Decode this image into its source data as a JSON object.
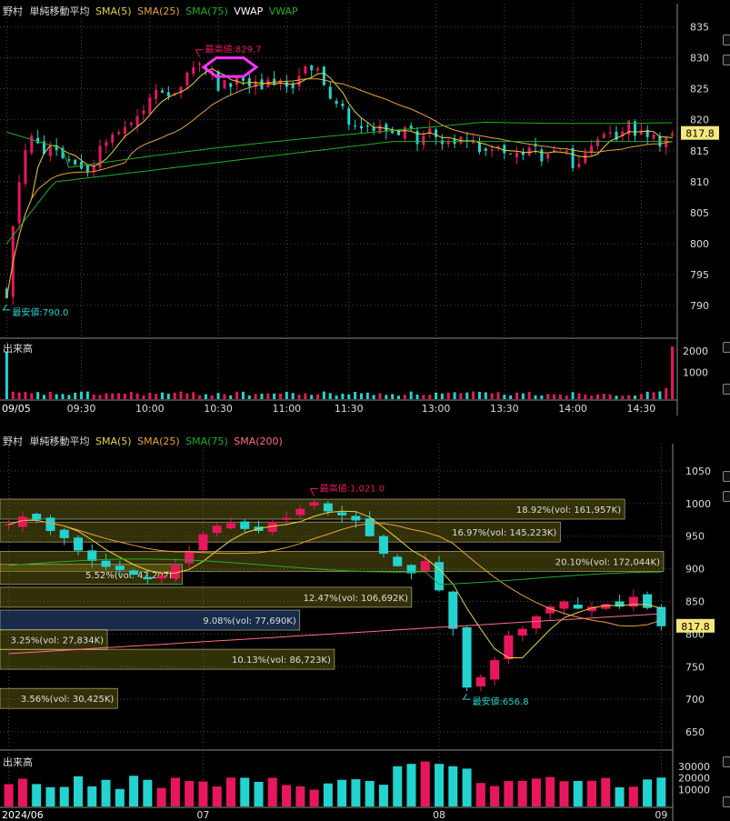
{
  "colors": {
    "up": "#e8175d",
    "down": "#23d3cf",
    "sma5": "#e8d43c",
    "sma25": "#e8a13c",
    "sma75": "#1fae2a",
    "vwap": "#ffffff",
    "sma200": "#ff6e86",
    "price_tag": "#f6e77a",
    "band": "#6f6a12",
    "band_active": "#203a63",
    "grid": "#4a4a4a",
    "frame": "#8a8a8a",
    "highlight": "#ff33ff"
  },
  "chart_data": [
    {
      "type": "candlestick",
      "title": "野村",
      "indicator": "単純移動平均",
      "legend": [
        {
          "name": "SMA(5)",
          "color": "#e8d43c"
        },
        {
          "name": "SMA(25)",
          "color": "#e8a13c"
        },
        {
          "name": "SMA(75)",
          "color": "#1fae2a"
        },
        {
          "name": "VWAP",
          "color": "#ffffff"
        },
        {
          "name": "VWAP",
          "color": "#1fae2a"
        }
      ],
      "ylim": [
        785,
        837
      ],
      "y_ticks": [
        835,
        830,
        825,
        820,
        815,
        810,
        805,
        800,
        795,
        790
      ],
      "x_tick_labels": [
        "09/05",
        "09:30",
        "10:00",
        "10:30",
        "11:00",
        "11:30",
        "13:00",
        "13:30",
        "14:00",
        "14:30"
      ],
      "x_tick_index": [
        0,
        12,
        23,
        34,
        45,
        55,
        69,
        80,
        91,
        102
      ],
      "current_price": "817.8",
      "high_label": "最高値:829.7",
      "low_label": "最安値:790.0",
      "close": [
        791.2,
        802.8,
        809.9,
        815.1,
        817.4,
        816.2,
        814.5,
        816.0,
        815.1,
        813.8,
        813.4,
        812.8,
        812.1,
        811.6,
        812.5,
        815.8,
        816.4,
        817.6,
        818.0,
        818.8,
        819.5,
        820.6,
        821.5,
        823.6,
        824.8,
        824.4,
        823.8,
        824.1,
        825.3,
        827.6,
        828.5,
        829.1,
        828.1,
        827.9,
        824.7,
        826.4,
        825.3,
        826.8,
        826.3,
        825.4,
        826.2,
        824.9,
        826.5,
        825.7,
        826.4,
        825.3,
        825.1,
        827.1,
        828.6,
        828.0,
        828.3,
        825.6,
        823.4,
        822.6,
        822.2,
        819.2,
        819.0,
        818.6,
        818.9,
        818.2,
        819.1,
        818.1,
        817.8,
        817.5,
        818.8,
        818.6,
        816.1,
        817.4,
        818.6,
        817.2,
        816.1,
        816.5,
        816.1,
        817.3,
        816.7,
        816.5,
        814.8,
        815.0,
        815.2,
        815.7,
        814.6,
        814.4,
        814.7,
        814.3,
        815.5,
        815.7,
        813.3,
        814.5,
        815.1,
        815.3,
        815.0,
        812.2,
        812.9,
        814.6,
        815.8,
        816.8,
        817.7,
        818.0,
        816.8,
        818.1,
        819.9,
        817.4,
        818.3,
        817.2,
        817.6,
        815.7,
        817.2,
        817.8
      ],
      "volume_panel": {
        "label": "出来高",
        "y_ticks": [
          "2000",
          "1000"
        ]
      }
    },
    {
      "type": "candlestick",
      "title": "野村",
      "indicator": "単純移動平均",
      "legend": [
        {
          "name": "SMA(5)",
          "color": "#e8d43c"
        },
        {
          "name": "SMA(25)",
          "color": "#e8a13c"
        },
        {
          "name": "SMA(75)",
          "color": "#1fae2a"
        },
        {
          "name": "SMA(200)",
          "color": "#ff6e86"
        }
      ],
      "ylim": [
        625,
        1075
      ],
      "y_ticks": [
        1050,
        1000,
        950,
        900,
        850,
        800,
        750,
        700,
        650
      ],
      "x_tick_labels": [
        "2024/06",
        "07",
        "08",
        "09"
      ],
      "x_tick_index": [
        0,
        14,
        31,
        47
      ],
      "current_price": "817.8",
      "high_label": "最高値:1,021.0",
      "low_label": "最安値:656.8",
      "close": [
        968,
        980,
        975,
        958,
        947,
        928,
        912,
        903,
        898,
        891,
        884,
        890,
        905,
        925,
        953,
        966,
        970,
        961,
        958,
        972,
        978,
        992,
        1002,
        988,
        982,
        974,
        950,
        923,
        904,
        893,
        912,
        867,
        808,
        718,
        734,
        760,
        798,
        808,
        827,
        842,
        850,
        839,
        842,
        846,
        842,
        857,
        840,
        812
      ],
      "volume_profile": [
        {
          "label": "18.92%(vol: 161,957K)",
          "pct": 18.92
        },
        {
          "label": "16.97%(vol: 145,223K)",
          "pct": 16.97
        },
        {
          "label": "20.10%(vol: 172,044K)",
          "pct": 20.1
        },
        {
          "label": "5.52%(vol: 47,207K)",
          "pct": 5.52
        },
        {
          "label": "12.47%(vol: 106,692K)",
          "pct": 12.47
        },
        {
          "label": "9.08%(vol: 77,690K)",
          "pct": 9.08
        },
        {
          "label": "3.25%(vol: 27,834K)",
          "pct": 3.25
        },
        {
          "label": "10.13%(vol: 86,723K)",
          "pct": 10.13
        },
        {
          "label": "3.56%(vol: 30,425K)",
          "pct": 3.56
        }
      ],
      "volume_panel": {
        "label": "出来高",
        "y_ticks": [
          "30000",
          "20000",
          "10000"
        ]
      }
    }
  ]
}
